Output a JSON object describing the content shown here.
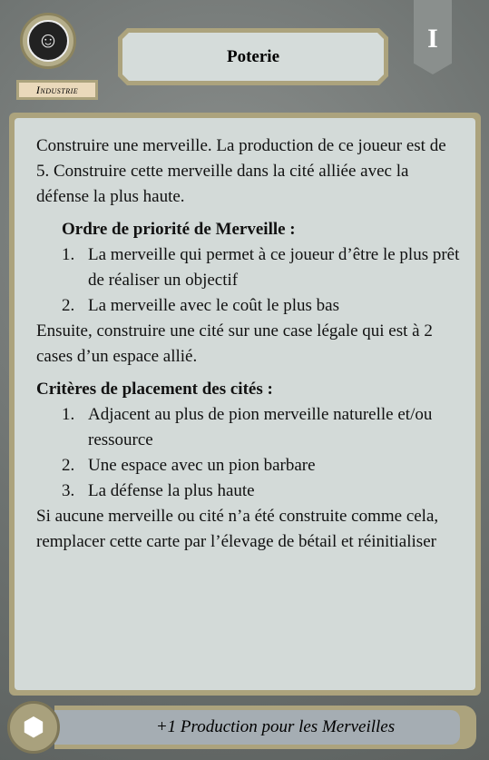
{
  "card": {
    "category": "Industrie",
    "title": "Poterie",
    "level": "I"
  },
  "body": {
    "intro": "Construire une merveille. La production de ce joueur est de 5. Construire cette merveille dans la cité alliée avec la défense la plus haute.",
    "wonder_priority": {
      "heading": "Ordre de priorité de Merveille :",
      "items": [
        "La merveille qui permet à ce joueur d’être le plus prêt de réaliser un objectif",
        "La merveille avec le coût le plus bas"
      ]
    },
    "then": "Ensuite, construire une cité sur une case légale qui est à 2 cases d’un espace allié.",
    "city_criteria": {
      "heading": "Critères de placement des cités :",
      "items": [
        "Adjacent au plus de pion merveille naturelle et/ou ressource",
        "Une espace avec un pion barbare",
        "La défense la plus haute"
      ]
    },
    "fallback": "Si aucune merveille ou cité n’a été construite comme cela, remplacer cette carte par l’élevage de bétail et réinitialiser"
  },
  "footer": {
    "bonus": "+1 Production pour les Merveilles"
  }
}
